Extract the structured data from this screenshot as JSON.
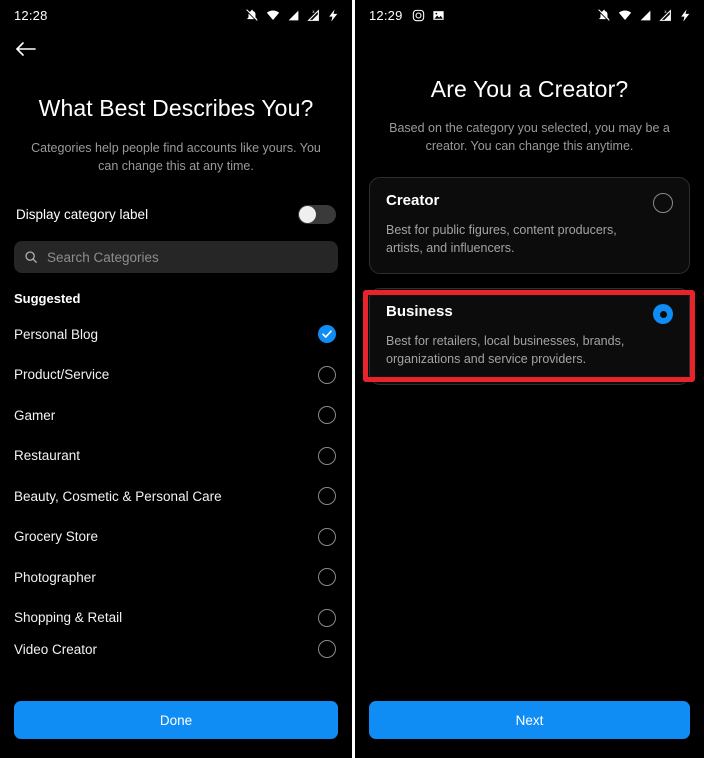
{
  "left_screen": {
    "status_bar": {
      "time": "12:28",
      "right_icons": [
        "bell-off-icon",
        "wifi-icon",
        "signal-icon",
        "signal-no-sim-icon",
        "battery-charging-icon"
      ]
    },
    "back_button": "back-arrow-icon",
    "title": "What Best Describes You?",
    "subtitle": "Categories help people find accounts like yours. You can change this at any time.",
    "toggle": {
      "label": "Display category label",
      "state": "off"
    },
    "search": {
      "placeholder": "Search Categories",
      "value": "",
      "icon": "search-icon"
    },
    "list_header": "Suggested",
    "categories": [
      {
        "label": "Personal Blog",
        "selected": true
      },
      {
        "label": "Product/Service",
        "selected": false
      },
      {
        "label": "Gamer",
        "selected": false
      },
      {
        "label": "Restaurant",
        "selected": false
      },
      {
        "label": "Beauty, Cosmetic & Personal Care",
        "selected": false
      },
      {
        "label": "Grocery Store",
        "selected": false
      },
      {
        "label": "Photographer",
        "selected": false
      },
      {
        "label": "Shopping & Retail",
        "selected": false
      },
      {
        "label": "Video Creator",
        "selected": false
      }
    ],
    "cta": "Done"
  },
  "right_screen": {
    "status_bar": {
      "time": "12:29",
      "left_icons": [
        "instagram-icon",
        "image-icon"
      ],
      "right_icons": [
        "bell-off-icon",
        "wifi-icon",
        "signal-icon",
        "signal-no-sim-icon",
        "battery-charging-icon"
      ]
    },
    "title": "Are You a Creator?",
    "subtitle": "Based on the category you selected, you may be a creator. You can change this anytime.",
    "options": [
      {
        "title": "Creator",
        "description": "Best for public figures, content producers, artists, and influencers.",
        "selected": false
      },
      {
        "title": "Business",
        "description": "Best for retailers, local businesses, brands, organizations and service providers.",
        "selected": true
      }
    ],
    "cta": "Next",
    "highlight_color": "#e8232a"
  },
  "colors": {
    "accent_blue": "#0f8df5",
    "background": "#000000",
    "card_border": "#2e2e2e",
    "muted_text": "#9a9a9a",
    "highlight_red": "#e8232a"
  }
}
